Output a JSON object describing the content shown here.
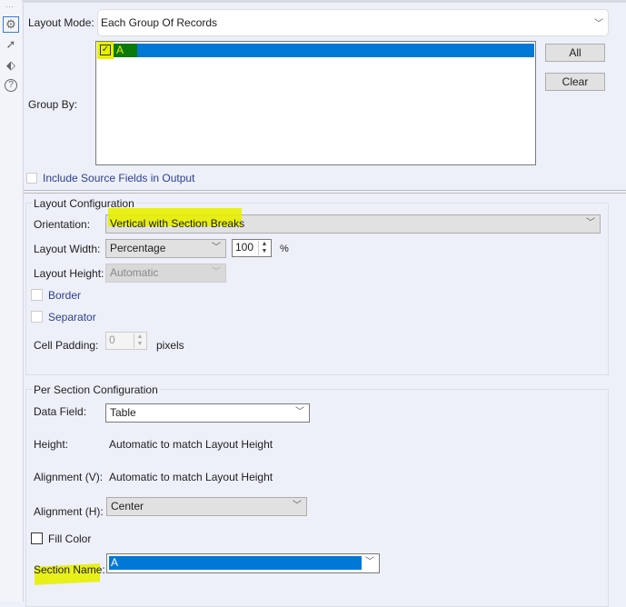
{
  "sidebar": {
    "icons": [
      "gear-icon",
      "export-icon",
      "tag-icon",
      "help-icon"
    ],
    "dots": "···"
  },
  "layout_mode": {
    "label": "Layout Mode:",
    "value": "Each Group Of Records"
  },
  "group_by": {
    "label": "Group By:",
    "items": [
      {
        "label": "A",
        "checked": true
      }
    ],
    "all_label": "All",
    "clear_label": "Clear"
  },
  "include_source": {
    "label": "Include Source Fields in Output",
    "checked": false
  },
  "layout_config": {
    "title": "Layout Configuration",
    "orientation": {
      "label": "Orientation:",
      "value": "Vertical with Section Breaks"
    },
    "width": {
      "label": "Layout Width:",
      "value": "Percentage",
      "amount": "100",
      "unit": "%"
    },
    "height": {
      "label": "Layout Height:",
      "value": "Automatic"
    },
    "border": {
      "label": "Border",
      "checked": false
    },
    "separator": {
      "label": "Separator",
      "checked": false
    },
    "cell_padding": {
      "label": "Cell Padding:",
      "value": "0",
      "unit": "pixels"
    }
  },
  "section_config": {
    "title": "Per Section Configuration",
    "data_field": {
      "label": "Data Field:",
      "value": "Table"
    },
    "height": {
      "label": "Height:",
      "value": "Automatic to match Layout Height"
    },
    "align_v": {
      "label": "Alignment (V):",
      "value": "Automatic to match Layout Height"
    },
    "align_h": {
      "label": "Alignment (H):",
      "value": "Center"
    },
    "fill_color": {
      "label": "Fill Color",
      "checked": false
    },
    "section_name": {
      "label": "Section Name:",
      "value": "A"
    }
  },
  "colors": {
    "selection": "#0078d7",
    "highlight": "#e8f000",
    "check_bg": "#0a7a0a"
  }
}
